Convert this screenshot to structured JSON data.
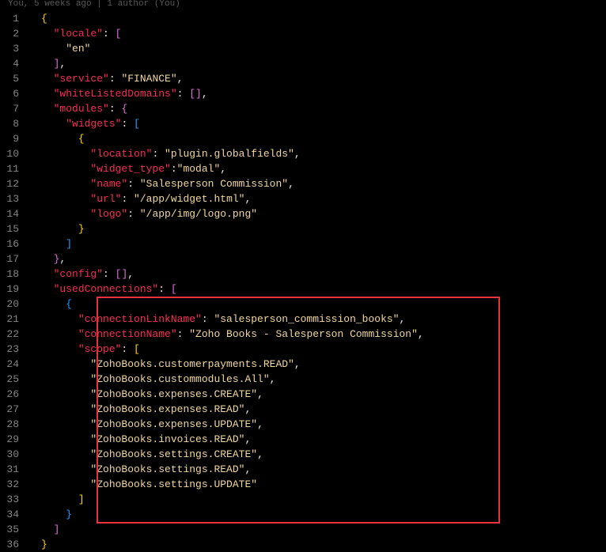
{
  "blame": "You, 5 weeks ago | 1 author (You)",
  "code": {
    "locale_key": "\"locale\"",
    "locale_val": "\"en\"",
    "service_key": "\"service\"",
    "service_val": "\"FINANCE\"",
    "wld_key": "\"whiteListedDomains\"",
    "modules_key": "\"modules\"",
    "widgets_key": "\"widgets\"",
    "location_key": "\"location\"",
    "location_val": "\"plugin.globalfields\"",
    "wtype_key": "\"widget_type\"",
    "wtype_val": "\"modal\"",
    "name_key": "\"name\"",
    "name_val": "\"Salesperson Commission\"",
    "url_key": "\"url\"",
    "url_val": "\"/app/widget.html\"",
    "logo_key": "\"logo\"",
    "logo_val": "\"/app/img/logo.png\"",
    "config_key": "\"config\"",
    "uc_key": "\"usedConnections\"",
    "cln_key": "\"connectionLinkName\"",
    "cln_val": "\"salesperson_commission_books\"",
    "cn_key": "\"connectionName\"",
    "cn_val": "\"Zoho Books - Salesperson Commission\"",
    "scope_key": "\"scope\"",
    "s1": "\"ZohoBooks.customerpayments.READ\"",
    "s2": "\"ZohoBooks.custommodules.All\"",
    "s3": "\"ZohoBooks.expenses.CREATE\"",
    "s4": "\"ZohoBooks.expenses.READ\"",
    "s5": "\"ZohoBooks.expenses.UPDATE\"",
    "s6": "\"ZohoBooks.invoices.READ\"",
    "s7": "\"ZohoBooks.settings.CREATE\"",
    "s8": "\"ZohoBooks.settings.READ\"",
    "s9": "\"ZohoBooks.settings.UPDATE\""
  },
  "ln": {
    "l1": "1",
    "l2": "2",
    "l3": "3",
    "l4": "4",
    "l5": "5",
    "l6": "6",
    "l7": "7",
    "l8": "8",
    "l9": "9",
    "l10": "10",
    "l11": "11",
    "l12": "12",
    "l13": "13",
    "l14": "14",
    "l15": "15",
    "l16": "16",
    "l17": "17",
    "l18": "18",
    "l19": "19",
    "l20": "20",
    "l21": "21",
    "l22": "22",
    "l23": "23",
    "l24": "24",
    "l25": "25",
    "l26": "26",
    "l27": "27",
    "l28": "28",
    "l29": "29",
    "l30": "30",
    "l31": "31",
    "l32": "32",
    "l33": "33",
    "l34": "34",
    "l35": "35",
    "l36": "36"
  }
}
